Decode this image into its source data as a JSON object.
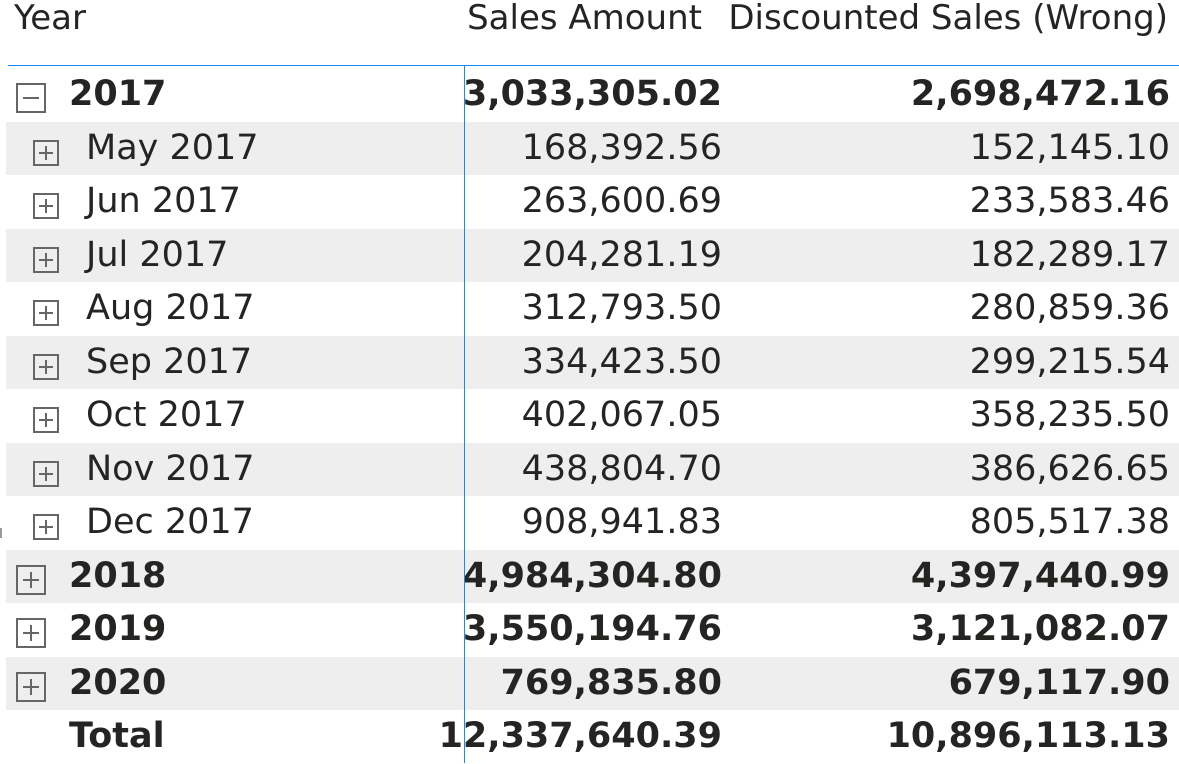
{
  "headers": {
    "year": "Year",
    "sales_amount": "Sales Amount",
    "discounted_sales": "Discounted Sales (Wrong)"
  },
  "rows": [
    {
      "label": "2017",
      "sales": "3,033,305.02",
      "discounted": "2,698,472.16",
      "level": "year",
      "expanded": true
    },
    {
      "label": "May 2017",
      "sales": "168,392.56",
      "discounted": "152,145.10",
      "level": "month"
    },
    {
      "label": "Jun 2017",
      "sales": "263,600.69",
      "discounted": "233,583.46",
      "level": "month"
    },
    {
      "label": "Jul 2017",
      "sales": "204,281.19",
      "discounted": "182,289.17",
      "level": "month"
    },
    {
      "label": "Aug 2017",
      "sales": "312,793.50",
      "discounted": "280,859.36",
      "level": "month"
    },
    {
      "label": "Sep 2017",
      "sales": "334,423.50",
      "discounted": "299,215.54",
      "level": "month"
    },
    {
      "label": "Oct 2017",
      "sales": "402,067.05",
      "discounted": "358,235.50",
      "level": "month"
    },
    {
      "label": "Nov 2017",
      "sales": "438,804.70",
      "discounted": "386,626.65",
      "level": "month"
    },
    {
      "label": "Dec 2017",
      "sales": "908,941.83",
      "discounted": "805,517.38",
      "level": "month"
    },
    {
      "label": "2018",
      "sales": "4,984,304.80",
      "discounted": "4,397,440.99",
      "level": "year",
      "expanded": false
    },
    {
      "label": "2019",
      "sales": "3,550,194.76",
      "discounted": "3,121,082.07",
      "level": "year",
      "expanded": false
    },
    {
      "label": "2020",
      "sales": "769,835.80",
      "discounted": "679,117.90",
      "level": "year",
      "expanded": false
    }
  ],
  "total": {
    "label": "Total",
    "sales": "12,337,640.39",
    "discounted": "10,896,113.13"
  },
  "colors": {
    "accent": "#118DFF",
    "row_shade": "#EEEEEE",
    "text": "#252423"
  }
}
